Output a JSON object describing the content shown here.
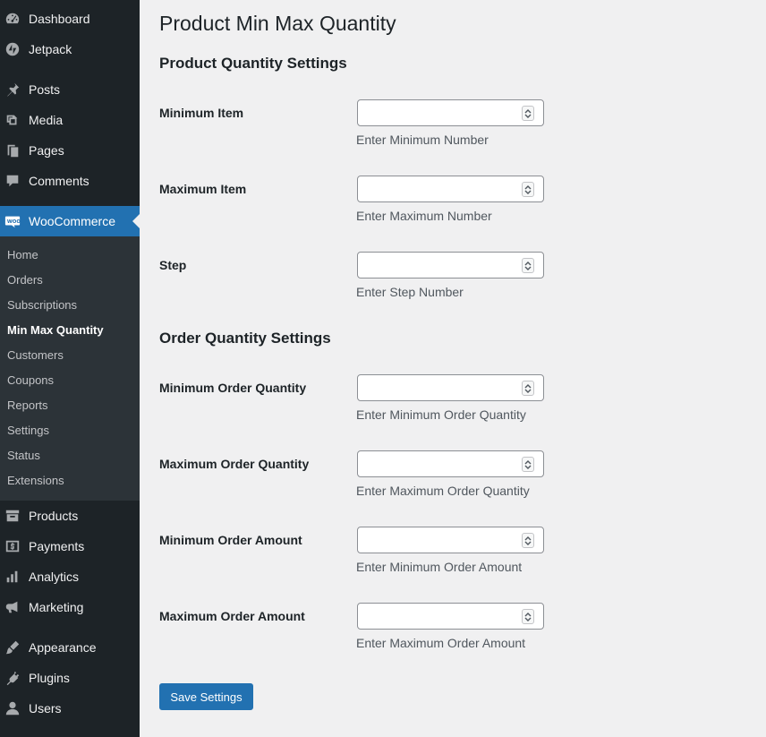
{
  "sidebar": {
    "top_items": [
      {
        "label": "Dashboard",
        "icon": "dashboard-icon"
      },
      {
        "label": "Jetpack",
        "icon": "jetpack-icon"
      }
    ],
    "content_items": [
      {
        "label": "Posts",
        "icon": "pin-icon"
      },
      {
        "label": "Media",
        "icon": "media-icon"
      },
      {
        "label": "Pages",
        "icon": "pages-icon"
      },
      {
        "label": "Comments",
        "icon": "comment-icon"
      }
    ],
    "woocommerce": {
      "label": "WooCommerce",
      "icon": "woocommerce-icon"
    },
    "woo_submenu": [
      "Home",
      "Orders",
      "Subscriptions",
      "Min Max Quantity",
      "Customers",
      "Coupons",
      "Reports",
      "Settings",
      "Status",
      "Extensions"
    ],
    "current_submenu": "Min Max Quantity",
    "commerce_items": [
      {
        "label": "Products",
        "icon": "products-icon"
      },
      {
        "label": "Payments",
        "icon": "payments-icon"
      },
      {
        "label": "Analytics",
        "icon": "analytics-icon"
      },
      {
        "label": "Marketing",
        "icon": "megaphone-icon"
      }
    ],
    "admin_items": [
      {
        "label": "Appearance",
        "icon": "brush-icon"
      },
      {
        "label": "Plugins",
        "icon": "plugin-icon"
      },
      {
        "label": "Users",
        "icon": "user-icon"
      }
    ]
  },
  "page": {
    "title": "Product Min Max Quantity",
    "product_section": "Product Quantity Settings",
    "order_section": "Order Quantity Settings",
    "fields": [
      {
        "label": "Minimum Item",
        "value": "",
        "description": "Enter Minimum Number"
      },
      {
        "label": "Maximum Item",
        "value": "",
        "description": "Enter Maximum Number"
      },
      {
        "label": "Step",
        "value": "",
        "description": "Enter Step Number"
      },
      {
        "label": "Minimum Order Quantity",
        "value": "",
        "description": "Enter Minimum Order Quantity"
      },
      {
        "label": "Maximum Order Quantity",
        "value": "",
        "description": "Enter Maximum Order Quantity"
      },
      {
        "label": "Minimum Order Amount",
        "value": "",
        "description": "Enter Minimum Order Amount"
      },
      {
        "label": "Maximum Order Amount",
        "value": "",
        "description": "Enter Maximum Order Amount"
      }
    ],
    "save_label": "Save Settings"
  },
  "colors": {
    "sidebar_bg": "#1d2327",
    "accent": "#2271b1",
    "page_bg": "#f0f0f1"
  }
}
